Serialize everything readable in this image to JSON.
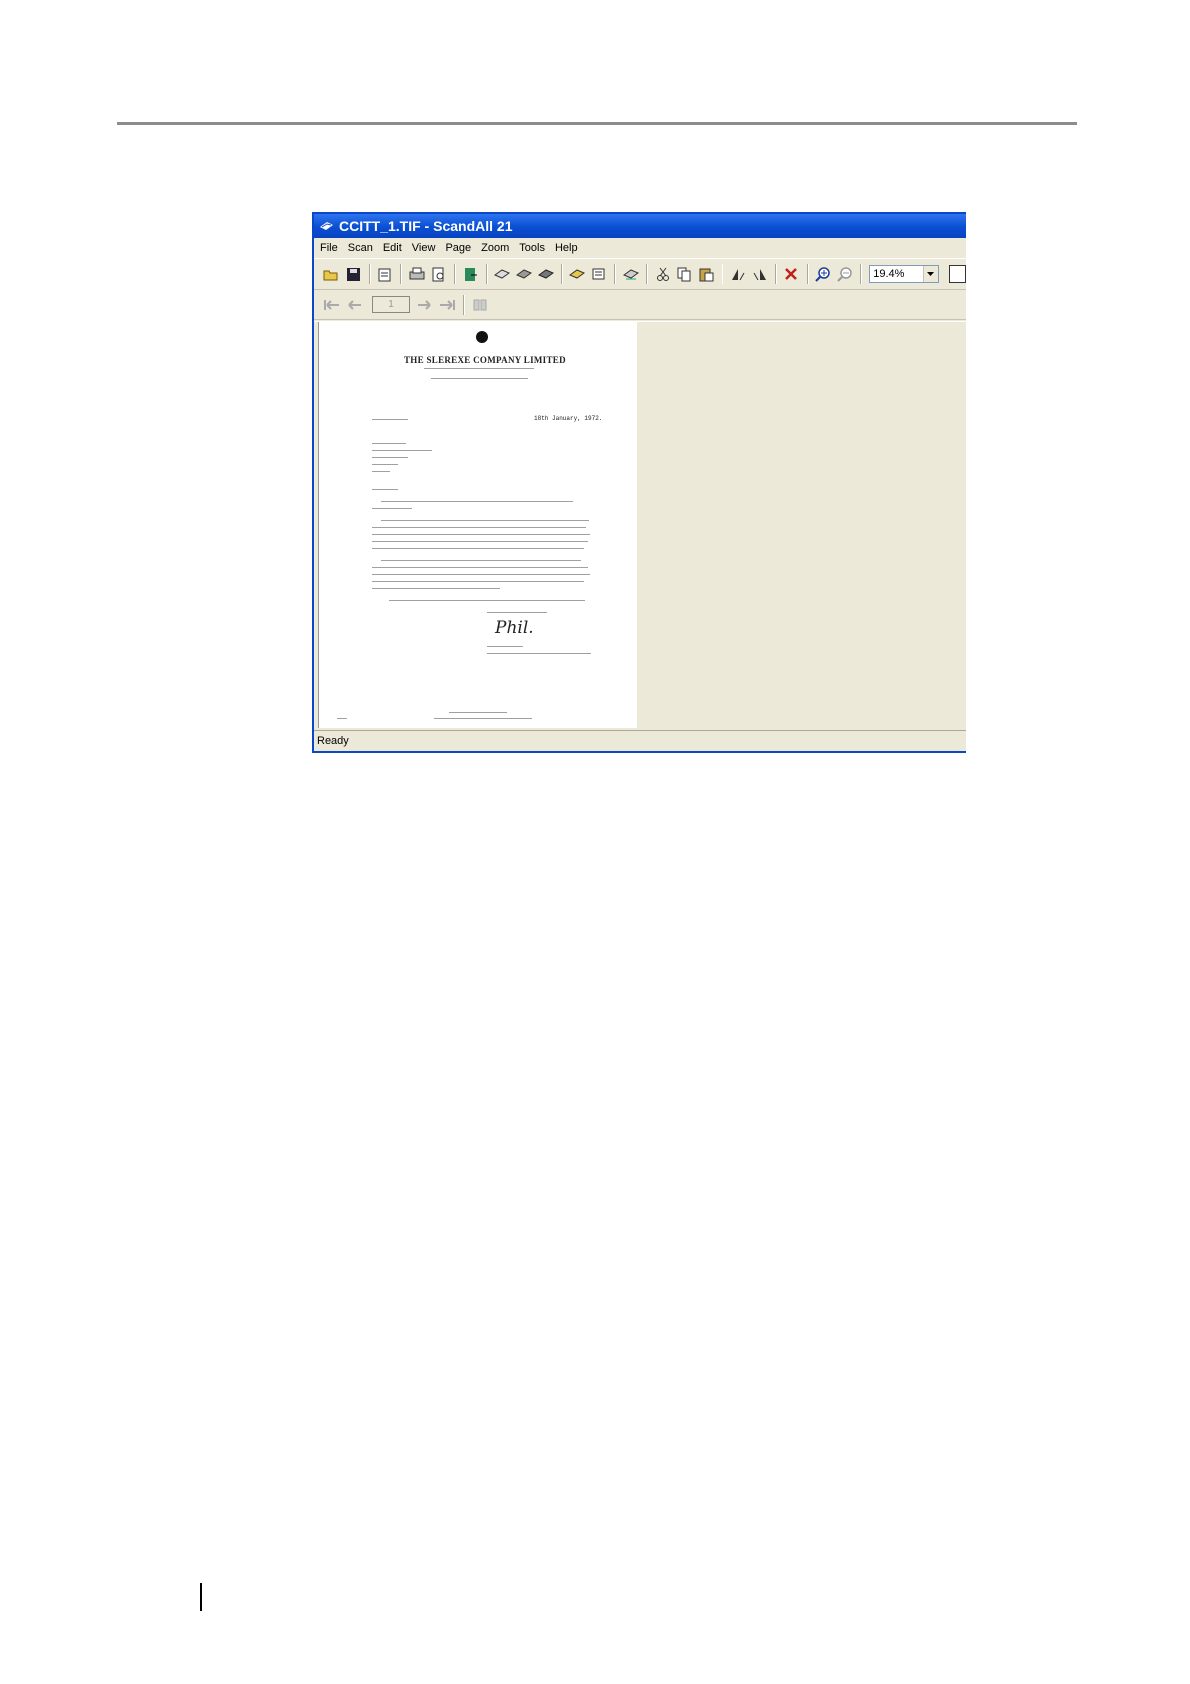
{
  "window": {
    "title": "CCITT_1.TIF - ScandAll 21"
  },
  "menu": [
    "File",
    "Scan",
    "Edit",
    "View",
    "Page",
    "Zoom",
    "Tools",
    "Help"
  ],
  "toolbar": {
    "icons": [
      "open-icon",
      "save-icon",
      "properties-icon",
      "print-icon",
      "print-preview-icon",
      "exit-icon",
      "scan-icon",
      "scan-multi-icon",
      "scan-setup-icon",
      "acquire-icon",
      "batch-scan-icon",
      "scan-to-icon",
      "cut-icon",
      "copy-icon",
      "paste-icon",
      "rotate-left-icon",
      "rotate-right-icon",
      "delete-icon",
      "zoom-in-icon",
      "zoom-out-icon"
    ],
    "zoom_value": "19.4%"
  },
  "navigation": {
    "page_number": "1"
  },
  "document": {
    "company": "THE SLEREXE COMPANY LIMITED",
    "date": "18th January, 1972.",
    "signature": "Phil."
  },
  "status": {
    "text": "Ready"
  }
}
